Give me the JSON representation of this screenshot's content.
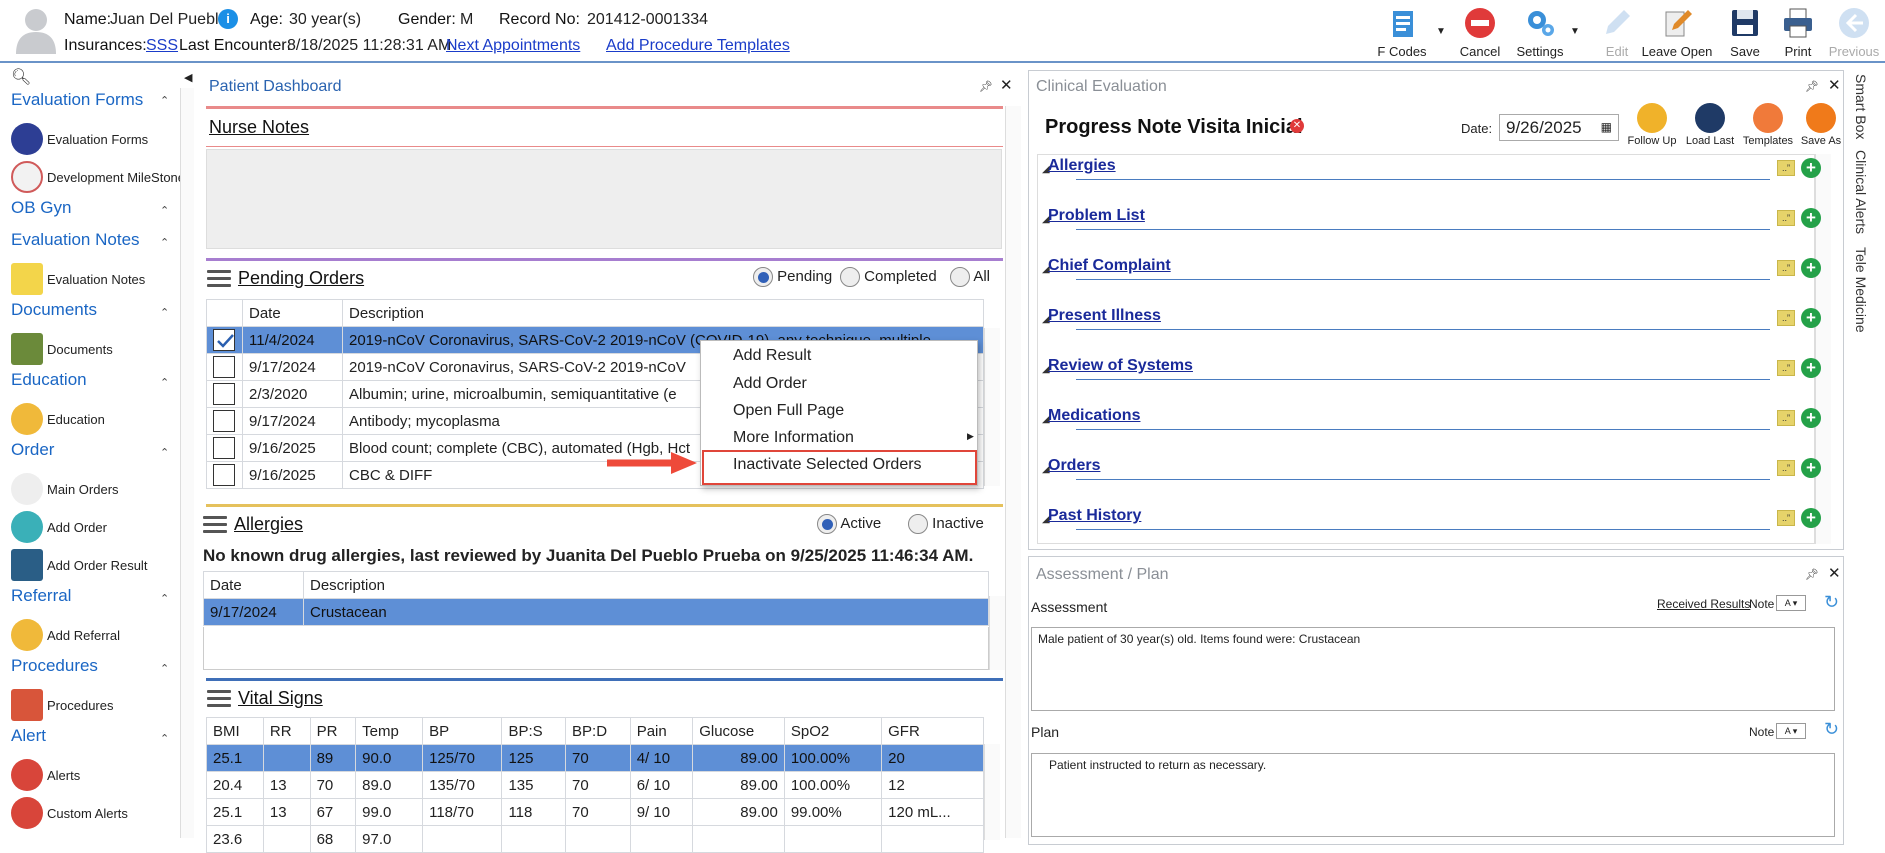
{
  "header": {
    "name_label": "Name:",
    "name": "Juan Del Pueblo",
    "age_label": "Age:",
    "age": "30 year(s)",
    "gender_label": "Gender:",
    "gender": "M",
    "record_label": "Record No:",
    "record": "201412-0001334",
    "ins_label": "Insurances:",
    "insurance": "SSS",
    "last_label": "Last Encounter:",
    "last_encounter": "8/18/2025 11:28:31 AM",
    "next_appointments": "Next Appointments",
    "add_procedure_templates": "Add Procedure Templates"
  },
  "toolbar": {
    "fcodes": "F Codes",
    "cancel": "Cancel",
    "settings": "Settings",
    "edit": "Edit",
    "leave_open": "Leave Open",
    "save": "Save",
    "print": "Print",
    "previous": "Previous"
  },
  "sidebar": {
    "evaluation_forms": "Evaluation Forms",
    "evaluation_forms_item": "Evaluation Forms",
    "development_milestones": "Development MileStones",
    "ob_gyn": "OB Gyn",
    "evaluation_notes": "Evaluation Notes",
    "evaluation_notes_item": "Evaluation Notes",
    "documents": "Documents",
    "documents_item": "Documents",
    "education": "Education",
    "education_item": "Education",
    "order": "Order",
    "main_orders": "Main Orders",
    "add_order": "Add Order",
    "add_order_result": "Add Order Result",
    "referral": "Referral",
    "add_referral": "Add Referral",
    "procedures": "Procedures",
    "procedures_item": "Procedures",
    "alert": "Alert",
    "alerts": "Alerts",
    "custom_alerts": "Custom Alerts"
  },
  "dashboard": {
    "title": "Patient Dashboard",
    "nurse_notes": "Nurse Notes",
    "pending_orders": "Pending Orders",
    "radio_pending": "Pending",
    "radio_completed": "Completed",
    "radio_all": "All",
    "orders_cols": [
      "Date",
      "Description"
    ],
    "orders": [
      {
        "date": "11/4/2024",
        "desc": "2019-nCoV Coronavirus, SARS-CoV-2 2019-nCoV (COVID-19), any technique, multiple"
      },
      {
        "date": "9/17/2024",
        "desc": "2019-nCoV Coronavirus, SARS-CoV-2 2019-nCoV"
      },
      {
        "date": "2/3/2020",
        "desc": "Albumin; urine, microalbumin, semiquantitative (e"
      },
      {
        "date": "9/17/2024",
        "desc": "Antibody; mycoplasma"
      },
      {
        "date": "9/16/2025",
        "desc": "Blood count; complete (CBC), automated (Hgb, Hct"
      },
      {
        "date": "9/16/2025",
        "desc": "CBC & DIFF"
      }
    ],
    "allergies": "Allergies",
    "radio_active": "Active",
    "radio_inactive": "Inactive",
    "allergy_note": "No known drug allergies, last reviewed by Juanita Del Pueblo Prueba on 9/25/2025 11:46:34 AM.",
    "allergy_cols": [
      "Date",
      "Description"
    ],
    "allergy_rows": [
      {
        "date": "9/17/2024",
        "desc": "Crustacean"
      }
    ],
    "vital_signs": "Vital Signs",
    "vital_cols": [
      "BMI",
      "RR",
      "PR",
      "Temp",
      "BP",
      "BP:S",
      "BP:D",
      "Pain",
      "Glucose",
      "SpO2",
      "GFR"
    ],
    "vital_rows": [
      [
        "25.1",
        "",
        "89",
        "90.0",
        "125/70",
        "125",
        "70",
        "4/ 10",
        "89.00",
        "100.00%",
        "20"
      ],
      [
        "20.4",
        "13",
        "70",
        "89.0",
        "135/70",
        "135",
        "70",
        "6/ 10",
        "89.00",
        "100.00%",
        "12"
      ],
      [
        "25.1",
        "13",
        "67",
        "99.0",
        "118/70",
        "118",
        "70",
        "9/ 10",
        "89.00",
        "99.00%",
        "120 mL..."
      ],
      [
        "23.6",
        "",
        "68",
        "97.0",
        "",
        "",
        "",
        "",
        "",
        "",
        ""
      ]
    ]
  },
  "context_menu": {
    "add_result": "Add Result",
    "add_order": "Add Order",
    "open_full_page": "Open Full Page",
    "more_information": "More Information",
    "inactivate": "Inactivate Selected Orders"
  },
  "clinical": {
    "title": "Clinical Evaluation",
    "note_title": "Progress Note Visita Inicial",
    "date_label": "Date:",
    "date": "9/26/2025",
    "follow_up": "Follow Up",
    "load_last": "Load Last",
    "templates": "Templates",
    "save_as": "Save As",
    "sections": [
      "Allergies",
      "Problem List",
      "Chief Complaint",
      "Present Illness",
      "Review of Systems",
      "Medications",
      "Orders",
      "Past History"
    ]
  },
  "assessment": {
    "title": "Assessment / Plan",
    "assessment_label": "Assessment",
    "received_results": "Received Results",
    "note_label": "Note",
    "assessment_text": "Male patient of 30 year(s) old. Items found were:  Crustacean",
    "plan_label": "Plan",
    "plan_text": "Patient instructed to return as necessary."
  },
  "right_tabs": [
    "Smart Box",
    "Clinical Alerts",
    "Tele Medicine"
  ],
  "colors": {
    "accent": "#2a63b0",
    "selected_row": "#5e8fd6",
    "highlight_box": "#e0463a"
  }
}
